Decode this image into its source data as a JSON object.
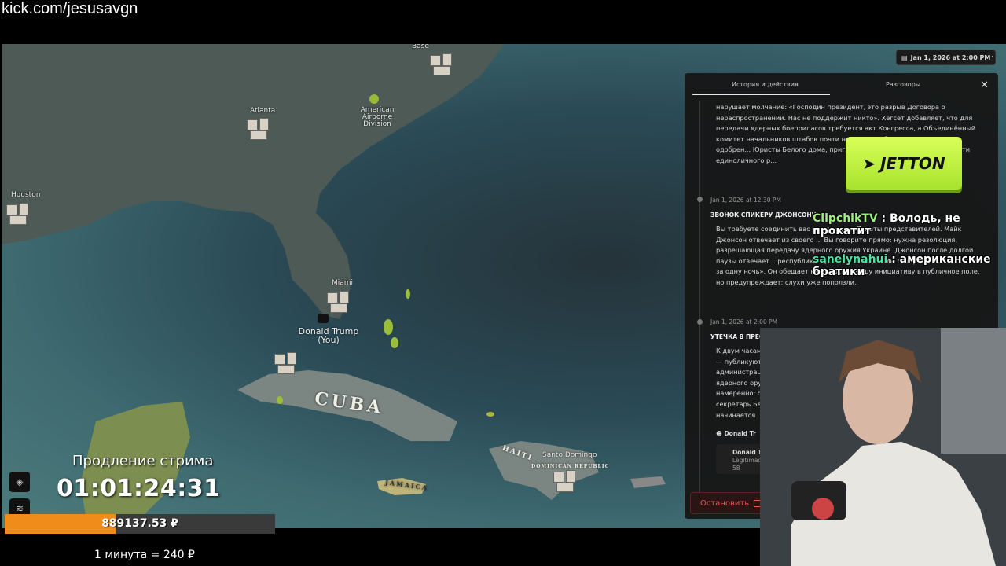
{
  "stream_url": "kick.com/jesusavgn",
  "map": {
    "cities": [
      {
        "name": "Base"
      },
      {
        "name": "Atlanta"
      },
      {
        "name": "American Airborne Division"
      },
      {
        "name": "Houston"
      },
      {
        "name": "Miami"
      },
      {
        "name": "Santo Domingo"
      }
    ],
    "countries": [
      "CUBA",
      "HAITI",
      "DOMINICAN REPUBLIC",
      "JAMAICA"
    ],
    "player": {
      "name": "Donald Trump",
      "tag": "(You)"
    }
  },
  "header": {
    "date": "Jan 1, 2026 at 2:00 PM",
    "more_icon": "ellipsis-icon"
  },
  "panel": {
    "tabs": [
      "История и действия",
      "Разговоры"
    ],
    "entry1_text": "нарушает молчание: «Господин президент, это разрыв Договора о нераспространении. Нас не поддержит никто». Хегсет добавляет, что для передачи ядерных боеприпасов требуется акт Конгресса, а Объединённый комитет начальников штабов почти на... приказ без законодательного одобрен... Юристы Белого дома, приглашённые с... неконституционности единоличного р...",
    "entry2_meta": "Jan 1, 2026 at 12:30 PM",
    "entry2_title": "ЗВОНОК СПИКЕРУ ДЖОНСОНУ",
    "entry2_text": "Вы требуете соединить вас со спикером Палаты представителей. Майк Джонсон отвечает из своего ... Вы говорите прямо: нужна резолюция, разрешающая передачу ядерного оружия Украине. Джонсон после долгой паузы отвечает... республиканцы этого не под... Мы потеряем большинство за одну ночь». Он обещает не выносить вашу инициативу в публичное поле, но предупреждает: слухи уже поползли.",
    "entry3_meta": "Jan 1, 2026 at 2:00 PM",
    "entry3_title": "УТЕЧКА В ПРЕСС",
    "entry3_text": "К двум часам — публикуют администрац ядерного ору намеренно: ф секретарь Бе начинается ш",
    "entry3_author": "Donald Tr",
    "entry3_card_name": "Donald Tr",
    "entry3_card_sub": "Legitimac",
    "entry3_card_stats": "58",
    "stop_label": "Остановить"
  },
  "sponsor": {
    "label": "JETTON"
  },
  "chat": [
    {
      "user": "ClipchikTV",
      "message": ": Володь, не прокатит"
    },
    {
      "user": "sanelynahui",
      "message": ": американские братики"
    }
  ],
  "overlay": {
    "timer_title": "Продление стрима",
    "timer_value": "01:01:24:31",
    "donation_amount": "889137.53 ₽",
    "donation_progress": 0.41,
    "rate": "1 минута = 240 ₽"
  },
  "colors": {
    "accent_orange": "#f08c1a",
    "chat_user": "#9cf07c",
    "stop_red": "#e05a5a",
    "sponsor_green": "#c5f43c"
  }
}
